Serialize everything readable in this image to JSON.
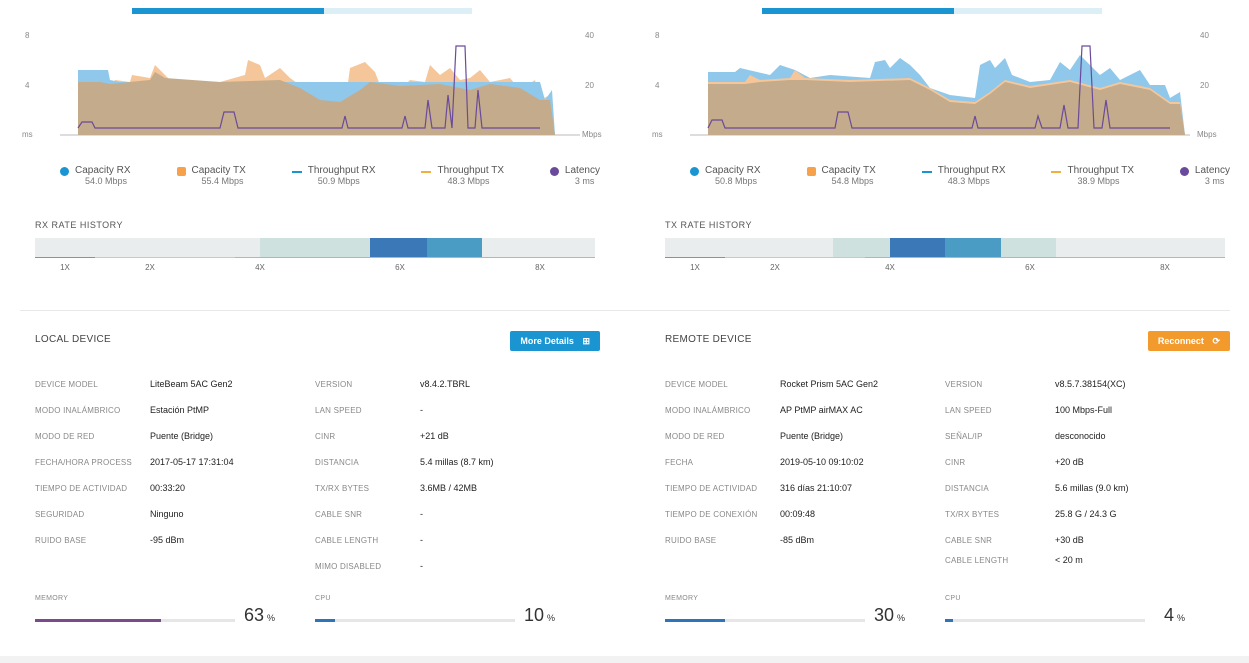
{
  "colors": {
    "capacity_rx": "#1a95d2",
    "capacity_tx": "#f7a24a",
    "throughput_rx": "#1a95d2",
    "throughput_tx": "#f0b040",
    "latency": "#6a4a9a",
    "rx_fill": "#8fc8ea",
    "tx_fill": "#f5c699",
    "overlap_fill": "#c4ab8b",
    "info_button": "#1a95d2",
    "warn_button": "#f39a2c",
    "memory_left": "#7b4a8c",
    "memory_right": "#2f74b8",
    "cpu": "#2f74b8"
  },
  "left": {
    "chart": {
      "left_ticks": [
        "8",
        "4",
        "ms"
      ],
      "right_ticks": [
        "40",
        "20",
        "Mbps"
      ]
    },
    "legend": [
      {
        "name": "Capacity RX",
        "value": "54.0 Mbps",
        "marker": "dot",
        "color_key": "capacity_rx"
      },
      {
        "name": "Capacity TX",
        "value": "55.4 Mbps",
        "marker": "dot",
        "color_key": "capacity_tx"
      },
      {
        "name": "Throughput RX",
        "value": "50.9 Mbps",
        "marker": "line",
        "color_key": "throughput_rx"
      },
      {
        "name": "Throughput TX",
        "value": "48.3 Mbps",
        "marker": "line",
        "color_key": "throughput_tx"
      },
      {
        "name": "Latency",
        "value": "3 ms",
        "marker": "dot",
        "color_key": "latency"
      }
    ],
    "rate_title": "RX RATE HISTORY",
    "rate_ticks": [
      "1X",
      "2X",
      "4X",
      "6X",
      "8X"
    ],
    "device": {
      "title": "LOCAL DEVICE",
      "button": "More Details",
      "rows_a": [
        {
          "k": "DEVICE MODEL",
          "v": "LiteBeam 5AC Gen2"
        },
        {
          "k": "MODO INALÁMBRICO",
          "v": "Estación PtMP"
        },
        {
          "k": "MODO DE RED",
          "v": "Puente (Bridge)"
        },
        {
          "k": "FECHA/HORA PROCESS",
          "v": "2017-05-17 17:31:04"
        },
        {
          "k": "TIEMPO DE ACTIVIDAD",
          "v": "00:33:20"
        },
        {
          "k": "SEGURIDAD",
          "v": "Ninguno"
        },
        {
          "k": "RUIDO BASE",
          "v": "-95 dBm"
        }
      ],
      "rows_b": [
        {
          "k": "VERSION",
          "v": "v8.4.2.TBRL"
        },
        {
          "k": "LAN SPEED",
          "v": "-"
        },
        {
          "k": "CINR",
          "v": "+21 dB"
        },
        {
          "k": "DISTANCIA",
          "v": "5.4 millas (8.7 km)"
        },
        {
          "k": "TX/RX BYTES",
          "v": "3.6MB / 42MB"
        },
        {
          "k": "CABLE SNR",
          "v": "-"
        },
        {
          "k": "CABLE LENGTH",
          "v": "-"
        },
        {
          "k": "MIMO DISABLED",
          "v": "-"
        }
      ],
      "memory": {
        "label": "MEMORY",
        "value": "63",
        "unit": "%",
        "fraction": 0.63
      },
      "cpu": {
        "label": "CPU",
        "value": "10",
        "unit": "%",
        "fraction": 0.1
      }
    }
  },
  "right": {
    "chart": {
      "left_ticks": [
        "8",
        "4",
        "ms"
      ],
      "right_ticks": [
        "40",
        "20",
        "Mbps"
      ]
    },
    "legend": [
      {
        "name": "Capacity RX",
        "value": "50.8 Mbps",
        "marker": "dot",
        "color_key": "capacity_rx"
      },
      {
        "name": "Capacity TX",
        "value": "54.8 Mbps",
        "marker": "dot",
        "color_key": "capacity_tx"
      },
      {
        "name": "Throughput RX",
        "value": "48.3 Mbps",
        "marker": "line",
        "color_key": "throughput_rx"
      },
      {
        "name": "Throughput TX",
        "value": "38.9 Mbps",
        "marker": "line",
        "color_key": "throughput_tx"
      },
      {
        "name": "Latency",
        "value": "3 ms",
        "marker": "dot",
        "color_key": "latency"
      }
    ],
    "rate_title": "TX RATE HISTORY",
    "rate_ticks": [
      "1X",
      "2X",
      "4X",
      "6X",
      "8X"
    ],
    "device": {
      "title": "REMOTE DEVICE",
      "button": "Reconnect",
      "rows_a": [
        {
          "k": "DEVICE MODEL",
          "v": "Rocket Prism 5AC Gen2"
        },
        {
          "k": "MODO INALÁMBRICO",
          "v": "AP PtMP airMAX AC"
        },
        {
          "k": "MODO DE RED",
          "v": "Puente (Bridge)"
        },
        {
          "k": "FECHA",
          "v": "2019-05-10 09:10:02"
        },
        {
          "k": "TIEMPO DE ACTIVIDAD",
          "v": "316 días 21:10:07"
        },
        {
          "k": "TIEMPO DE CONEXIÓN",
          "v": "00:09:48"
        },
        {
          "k": "RUIDO BASE",
          "v": "-85 dBm"
        }
      ],
      "rows_b": [
        {
          "k": "VERSION",
          "v": "v8.5.7.38154(XC)"
        },
        {
          "k": "LAN SPEED",
          "v": "100 Mbps-Full"
        },
        {
          "k": "SEÑAL/IP",
          "v": "desconocido"
        },
        {
          "k": "CINR",
          "v": "+20 dB"
        },
        {
          "k": "DISTANCIA",
          "v": "5.6 millas (9.0 km)"
        },
        {
          "k": "TX/RX BYTES",
          "v": "25.8 G / 24.3 G"
        },
        {
          "k": "CABLE SNR",
          "v": "+30 dB"
        },
        {
          "k": "CABLE LENGTH",
          "v": "< 20 m"
        }
      ],
      "memory": {
        "label": "MEMORY",
        "value": "30",
        "unit": "%",
        "fraction": 0.3
      },
      "cpu": {
        "label": "CPU",
        "value": "4",
        "unit": "%",
        "fraction": 0.04
      }
    }
  }
}
